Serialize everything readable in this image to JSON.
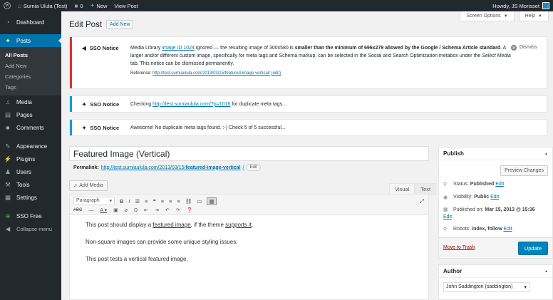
{
  "adminbar": {
    "site_name": "Surnia Ulula (Test)",
    "comments_count": "0",
    "new_label": "New",
    "view_post": "View Post",
    "greeting": "Howdy, JS Morisset"
  },
  "sidebar": {
    "items": [
      {
        "label": "Dashboard",
        "icon": "dashboard-icon"
      },
      {
        "label": "Posts",
        "icon": "pin-icon"
      },
      {
        "label": "Media",
        "icon": "media-icon"
      },
      {
        "label": "Pages",
        "icon": "pages-icon"
      },
      {
        "label": "Comments",
        "icon": "comments-icon"
      },
      {
        "label": "Appearance",
        "icon": "brush-icon"
      },
      {
        "label": "Plugins",
        "icon": "plug-icon"
      },
      {
        "label": "Users",
        "icon": "users-icon"
      },
      {
        "label": "Tools",
        "icon": "wrench-icon"
      },
      {
        "label": "Settings",
        "icon": "settings-icon"
      },
      {
        "label": "SSO Free",
        "icon": "sso-icon"
      },
      {
        "label": "Collapse menu",
        "icon": "collapse-icon"
      }
    ],
    "posts_submenu": [
      "All Posts",
      "Add New",
      "Categories",
      "Tags"
    ]
  },
  "header": {
    "screen_options": "Screen Options",
    "help": "Help",
    "title": "Edit Post",
    "add_new": "Add New"
  },
  "notices": [
    {
      "label": "SSO Notice",
      "pre": "Media Library ",
      "link": "image ID 1024",
      "mid1": " ignored — the resulting image of 300x580 is ",
      "bold1": "smaller than the minimum of 696x279 allowed by the Google / Schema Article standard",
      "mid2": ". A larger and/or different custom image, specifically for meta tags and Schema markup, can be selected in the Social and Search Optimization metabox under the ",
      "em": "Select Media",
      "post": " tab. This notice can be dismissed permanently.",
      "ref_label": "Reference: ",
      "ref_link": "http://test.surniaulula.com/2013/03/15/featured-image-vertical/",
      "ref_edit": "(edit)",
      "dismiss": "Dismiss",
      "accent": "#dc3232"
    },
    {
      "label": "SSO Notice",
      "pre": "Checking ",
      "link": "http://test.surniaulula.com/?p=1016",
      "post": " for duplicate meta tags...",
      "accent": "#00a0d2"
    },
    {
      "label": "SSO Notice",
      "text": "Awesome! No duplicate meta tags found. :-) Check 5 of 5 successful...",
      "accent": "#00a0d2"
    }
  ],
  "editor": {
    "post_title": "Featured Image (Vertical)",
    "permalink_label": "Permalink:",
    "permalink_base": "http://test.surniaulula.com/2013/03/15/",
    "permalink_slug": "featured-image-vertical",
    "permalink_end": "/",
    "edit": "Edit",
    "add_media": "Add Media",
    "tab_visual": "Visual",
    "tab_text": "Text",
    "format": "Paragraph",
    "body": {
      "p1_pre": "This post should display a ",
      "p1_link1": "featured image",
      "p1_mid": ", if the theme ",
      "p1_link2": "supports it",
      "p1_post": ".",
      "p2": "Non-square images can provide some unique styling issues.",
      "p3": "This post tests a vertical featured image."
    }
  },
  "publish": {
    "title": "Publish",
    "preview": "Preview Changes",
    "status_label": "Status:",
    "status_value": "Published",
    "visibility_label": "Visibility:",
    "visibility_value": "Public",
    "published_label": "Published on:",
    "published_value": "Mar 15, 2013 @ 15:36",
    "robots_label": "Robots:",
    "robots_value": "index, follow",
    "edit": "Edit",
    "trash": "Move to Trash",
    "update": "Update"
  },
  "author": {
    "title": "Author",
    "value": "John Saddington (saddington)"
  }
}
